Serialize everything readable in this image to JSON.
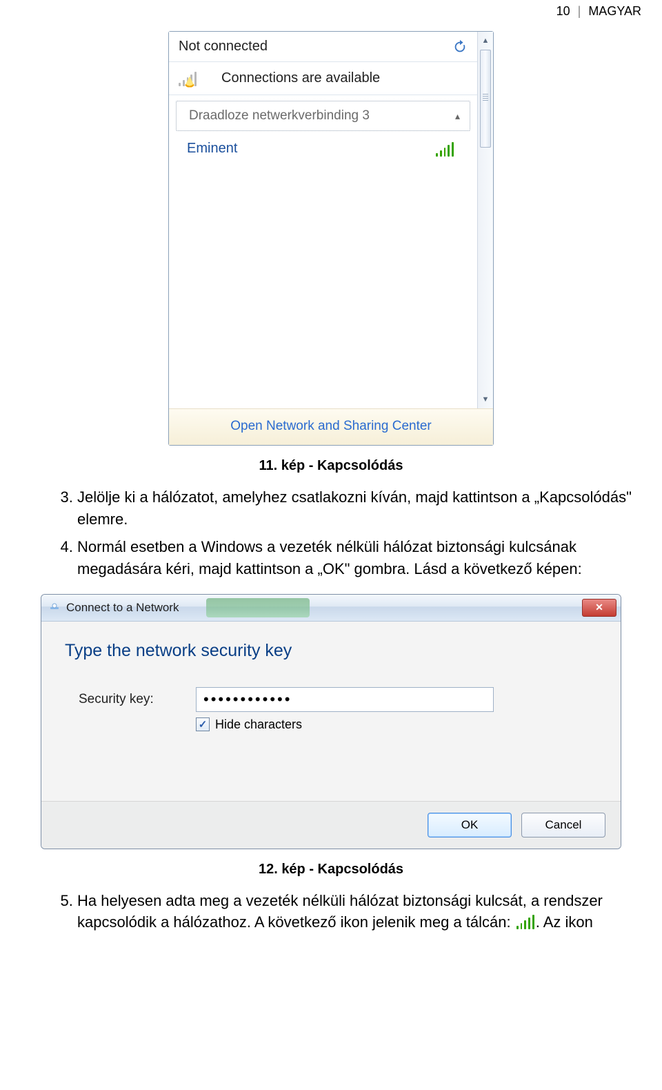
{
  "header": {
    "page_num": "10",
    "lang": "MAGYAR"
  },
  "flyout": {
    "not_connected": "Not connected",
    "available": "Connections are available",
    "section_label": "Draadloze netwerkverbinding 3",
    "wifi": {
      "items": [
        {
          "ssid": "Eminent"
        }
      ]
    },
    "footer_link": "Open Network and Sharing Center"
  },
  "caption11": "11. kép - Kapcsolódás",
  "steps_a": [
    "Jelölje ki a hálózatot, amelyhez csatlakozni kíván, majd kattintson a „Kapcsolódás\" elemre.",
    "Normál esetben a Windows a vezeték nélküli hálózat biztonsági kulcsának megadására kéri, majd kattintson a „OK\" gombra. Lásd a következő képen:"
  ],
  "dialog": {
    "title": "Connect to a Network",
    "heading": "Type the network security key",
    "key_label": "Security key:",
    "key_value": "••••••••••••",
    "hide_label": "Hide characters",
    "ok": "OK",
    "cancel": "Cancel"
  },
  "caption12": "12. kép - Kapcsolódás",
  "step5_pre": "Ha helyesen adta meg a vezeték nélküli hálózat biztonsági kulcsát, a rendszer kapcsolódik a hálózathoz. A következő ikon jelenik meg a tálcán:",
  "step5_post": ". Az ikon"
}
